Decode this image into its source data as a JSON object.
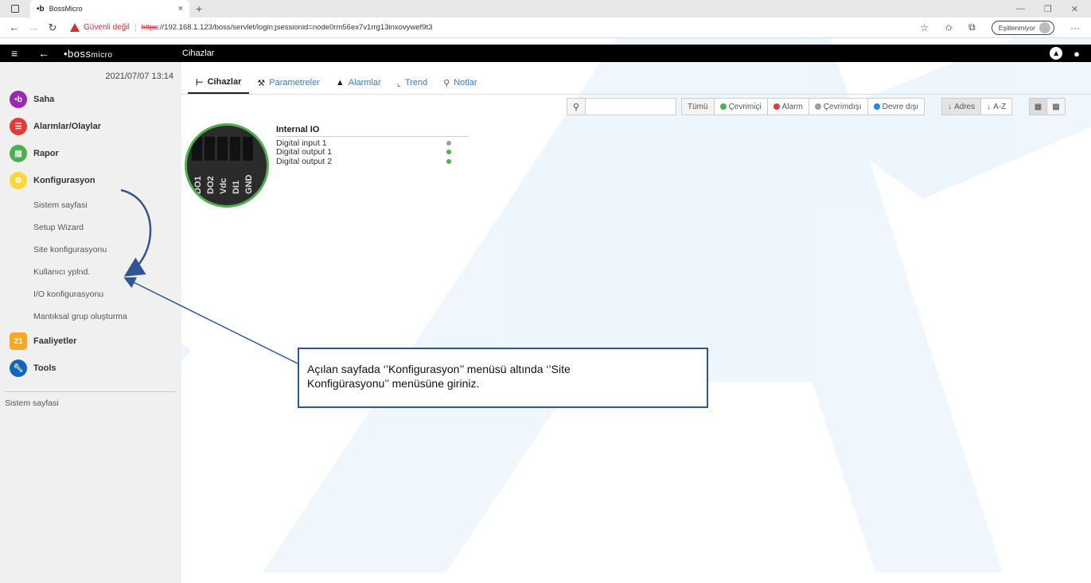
{
  "browser": {
    "tab_logo": "•b",
    "tab_title": "BossMicro",
    "tab_close": "×",
    "new_tab": "+",
    "security_warning": "Güvenli değil",
    "url_proto": "https",
    "url_rest": "://192.168.1.123/boss/servlet/login;jsessionid=node0rm56ex7v1rrg13inxovywef9t3",
    "sync_label": "Eşitlenmiyor",
    "more": "···"
  },
  "appbar": {
    "brand_mark": "•b",
    "brand_name": "oss",
    "brand_sub": "micro",
    "title": "Cihazlar"
  },
  "sidebar": {
    "datetime": "2021/07/07  13:14",
    "items": [
      {
        "label": "Saha",
        "icon": "saha-icon",
        "color": "#9c27b0"
      },
      {
        "label": "Alarmlar/Olaylar",
        "icon": "alarm-list-icon",
        "color": "#e53935"
      },
      {
        "label": "Rapor",
        "icon": "report-icon",
        "color": "#4caf50"
      },
      {
        "label": "Konfigurasyon",
        "icon": "config-gears-icon",
        "color": "#fdd835"
      }
    ],
    "subitems": [
      "Sistem sayfasi",
      "Setup Wizard",
      "Site konfigurasyonu",
      "Kullanıcı yplnd.",
      "I/O konfigurasyonu",
      "Mantıksal grup oluşturma"
    ],
    "items2": [
      {
        "label": "Faaliyetler",
        "icon": "calendar-icon",
        "color": "#f9a825",
        "glyph": "21"
      },
      {
        "label": "Tools",
        "icon": "wrench-icon",
        "color": "#1565c0"
      }
    ],
    "footer": "Sistem sayfasi"
  },
  "tabs": [
    {
      "label": "Cihazlar",
      "icon": "devices-icon",
      "active": true
    },
    {
      "label": "Parametreler",
      "icon": "wrench-tab-icon",
      "active": false
    },
    {
      "label": "Alarmlar",
      "icon": "bell-tab-icon",
      "active": false
    },
    {
      "label": "Trend",
      "icon": "trend-icon",
      "active": false
    },
    {
      "label": "Notlar",
      "icon": "pin-icon",
      "active": false
    }
  ],
  "toolbar": {
    "search_value": "",
    "filters": [
      {
        "label": "Tümü",
        "dot": null
      },
      {
        "label": "Çevrimiçi",
        "dot": "#4caf50"
      },
      {
        "label": "Alarm",
        "dot": "#e53935"
      },
      {
        "label": "Çevrimdışı",
        "dot": "#9e9e9e"
      },
      {
        "label": "Devre dışı",
        "dot": "#1e88e5"
      }
    ],
    "sort_address": "Adres",
    "sort_az": "A-Z"
  },
  "device": {
    "title": "Internal IO",
    "pin_labels": [
      "DO1",
      "DO2",
      "Vdc",
      "DI1",
      "GND"
    ],
    "rows": [
      {
        "label": "Digital input 1",
        "status_color": "#9e9e9e"
      },
      {
        "label": "Digital output 1",
        "status_color": "#4caf50"
      },
      {
        "label": "Digital output 2",
        "status_color": "#4caf50"
      }
    ]
  },
  "annotation": {
    "text_line1": "Açılan sayfada ‘’Konfigurasyon’’ menüsü altında ‘’Site",
    "text_line2": "Konfigürasyonu’’ menüsüne giriniz."
  },
  "colors": {
    "accent": "#3a7bd5",
    "annotation": "#2f5597",
    "watermark": "#1e88e5"
  }
}
